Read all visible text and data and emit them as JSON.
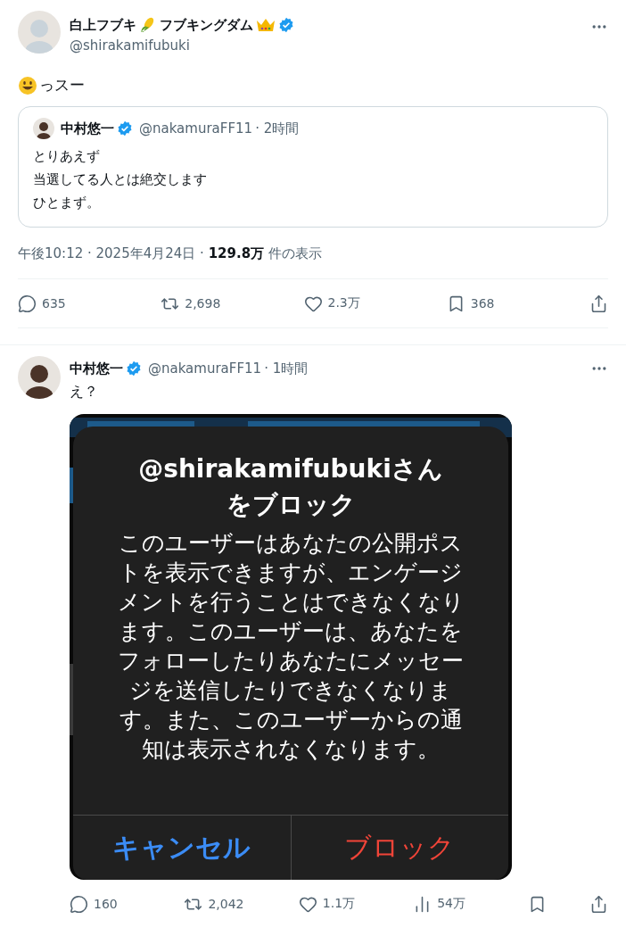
{
  "main_post": {
    "author": {
      "name": "白上フブキ",
      "name_suffix": "フブキングダム",
      "verified": true,
      "handle": "@shirakamifubuki"
    },
    "text": "っスー",
    "quote": {
      "author": {
        "name": "中村悠一",
        "verified": true,
        "handle": "@nakamuraFF11",
        "time": "· 2時間"
      },
      "lines": [
        "とりあえず",
        "当選してる人とは絶交します",
        "ひとまず。"
      ]
    },
    "meta": "午後10:12 · 2025年4月24日 · **129.8万** 件の表示",
    "actions": [
      {
        "kind": "reply",
        "count": "635"
      },
      {
        "kind": "repost",
        "count": "2,698"
      },
      {
        "kind": "like",
        "count": "2.3万"
      },
      {
        "kind": "bookmark",
        "count": "368"
      },
      {
        "kind": "share"
      }
    ]
  },
  "reply_post": {
    "author": {
      "name": "中村悠一",
      "verified": true,
      "handle": "@nakamuraFF11",
      "time": "· 1時間"
    },
    "text": "え？",
    "media": {
      "kind": "picture",
      "dialog": {
        "title_lines": [
          "@shirakamifubukiさん",
          "をブロック"
        ],
        "message": "このユーザーはあなたの公開ポストを表示できますが、エンゲージメントを行うことはできなくなります。このユーザーは、あなたをフォローしたりあなたにメッセージを送信したりできなくなります。また、このユーザーからの通知は表示されなくなります。",
        "buttons": [
          {
            "kind": "cancel",
            "label": "キャンセル"
          },
          {
            "kind": "destructive",
            "label": "ブロック"
          }
        ]
      }
    },
    "actions": [
      {
        "kind": "reply",
        "count": "160"
      },
      {
        "kind": "repost",
        "count": "2,042"
      },
      {
        "kind": "like",
        "count": "1.1万"
      },
      {
        "kind": "views",
        "count": "54万"
      },
      {
        "kind": "bookmark"
      },
      {
        "kind": "share"
      }
    ]
  }
}
